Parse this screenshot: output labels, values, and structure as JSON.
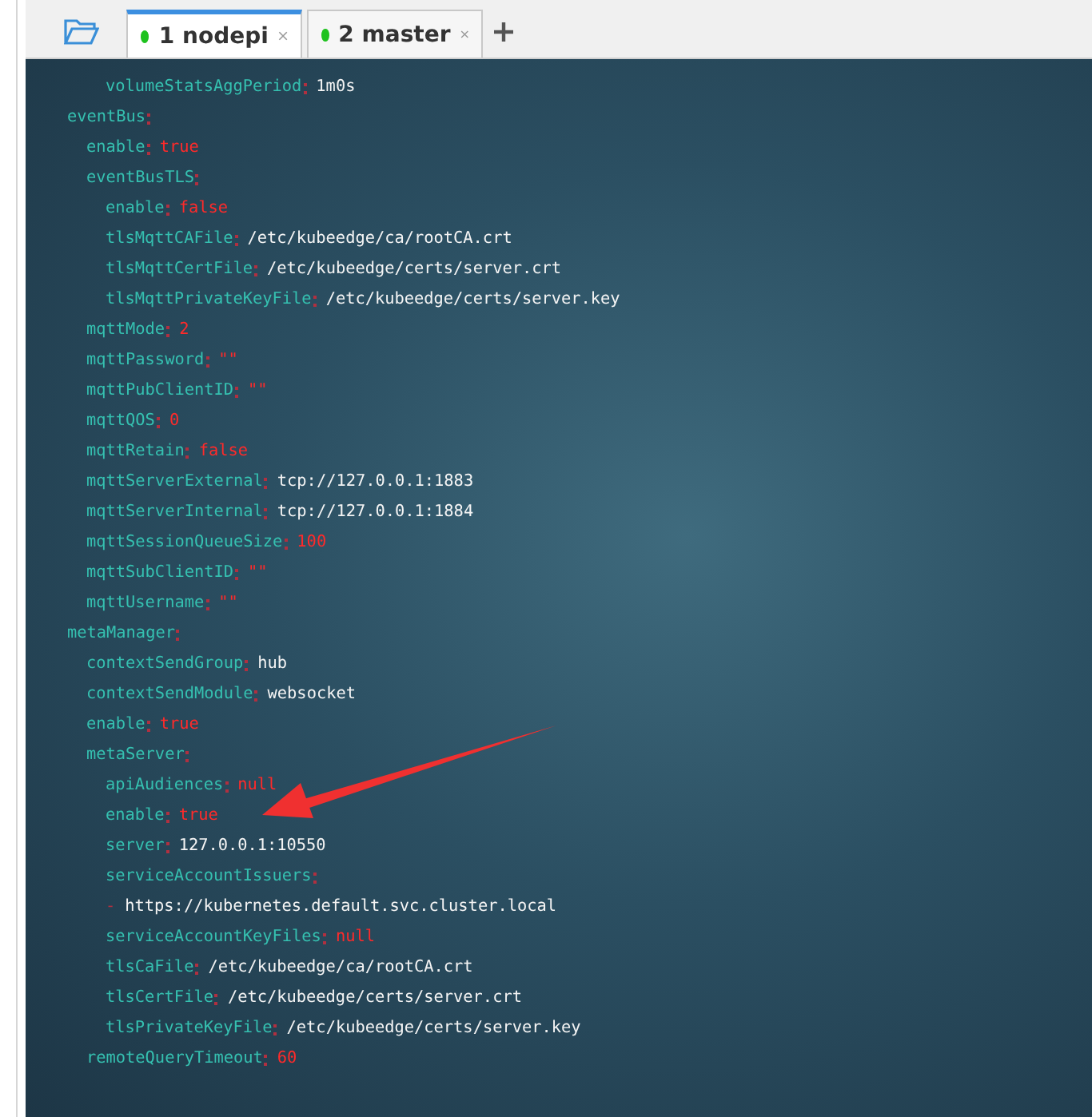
{
  "tabs": [
    {
      "label": "1 nodepi",
      "selected": true,
      "connected": true
    },
    {
      "label": "2 master",
      "selected": false,
      "connected": true
    }
  ],
  "terminal": {
    "lines": [
      {
        "children": [
          {
            "children": [
              {
                "key": "volumeStatsAggPeriod",
                "value": "1m0s",
                "kind": "string"
              }
            ]
          }
        ]
      },
      {
        "key": "eventBus",
        "children": [
          {
            "key": "enable",
            "value": "true",
            "kind": "keyword"
          },
          {
            "key": "eventBusTLS",
            "children": [
              {
                "key": "enable",
                "value": "false",
                "kind": "keyword"
              },
              {
                "key": "tlsMqttCAFile",
                "value": "/etc/kubeedge/ca/rootCA.crt",
                "kind": "string"
              },
              {
                "key": "tlsMqttCertFile",
                "value": "/etc/kubeedge/certs/server.crt",
                "kind": "string"
              },
              {
                "key": "tlsMqttPrivateKeyFile",
                "value": "/etc/kubeedge/certs/server.key",
                "kind": "string"
              }
            ]
          },
          {
            "key": "mqttMode",
            "value": "2",
            "kind": "keyword"
          },
          {
            "key": "mqttPassword",
            "value": "\"\"",
            "kind": "keyword"
          },
          {
            "key": "mqttPubClientID",
            "value": "\"\"",
            "kind": "keyword"
          },
          {
            "key": "mqttQOS",
            "value": "0",
            "kind": "keyword"
          },
          {
            "key": "mqttRetain",
            "value": "false",
            "kind": "keyword"
          },
          {
            "key": "mqttServerExternal",
            "value": "tcp://127.0.0.1:1883",
            "kind": "string"
          },
          {
            "key": "mqttServerInternal",
            "value": "tcp://127.0.0.1:1884",
            "kind": "string"
          },
          {
            "key": "mqttSessionQueueSize",
            "value": "100",
            "kind": "keyword"
          },
          {
            "key": "mqttSubClientID",
            "value": "\"\"",
            "kind": "keyword"
          },
          {
            "key": "mqttUsername",
            "value": "\"\"",
            "kind": "keyword"
          }
        ]
      },
      {
        "key": "metaManager",
        "children": [
          {
            "key": "contextSendGroup",
            "value": "hub",
            "kind": "string"
          },
          {
            "key": "contextSendModule",
            "value": "websocket",
            "kind": "string"
          },
          {
            "key": "enable",
            "value": "true",
            "kind": "keyword"
          },
          {
            "key": "metaServer",
            "children": [
              {
                "key": "apiAudiences",
                "value": "null",
                "kind": "keyword"
              },
              {
                "key": "enable",
                "value": "true",
                "kind": "keyword"
              },
              {
                "key": "server",
                "value": "127.0.0.1:10550",
                "kind": "string"
              },
              {
                "key": "serviceAccountIssuers"
              },
              {
                "marker": "-",
                "item": "https://kubernetes.default.svc.cluster.local"
              },
              {
                "key": "serviceAccountKeyFiles",
                "value": "null",
                "kind": "keyword"
              },
              {
                "key": "tlsCaFile",
                "value": "/etc/kubeedge/ca/rootCA.crt",
                "kind": "string"
              },
              {
                "key": "tlsCertFile",
                "value": "/etc/kubeedge/certs/server.crt",
                "kind": "string"
              },
              {
                "key": "tlsPrivateKeyFile",
                "value": "/etc/kubeedge/certs/server.key",
                "kind": "string"
              }
            ]
          },
          {
            "key": "remoteQueryTimeout",
            "value": "60",
            "kind": "keyword"
          }
        ]
      }
    ]
  },
  "annotation": {
    "kind": "arrow"
  }
}
